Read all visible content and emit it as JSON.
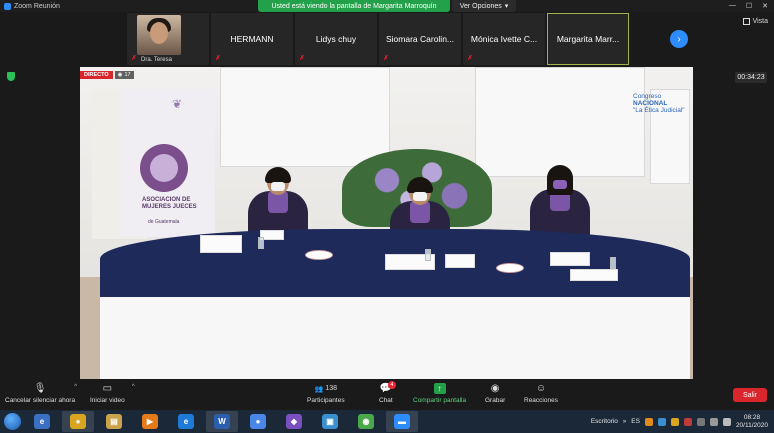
{
  "window": {
    "title": "Zoom Reunión",
    "minimize_label": "—",
    "maximize_label": "☐",
    "close_label": "✕"
  },
  "banner": {
    "share_notice": "Usted está viendo la pantalla de Margarita Marroquín",
    "view_options": "Ver Opciones",
    "view_options_caret": "▾"
  },
  "gallery": {
    "participants": [
      {
        "name": "Dra. Teresa",
        "has_video": true
      },
      {
        "name": "HERMANN",
        "has_video": false
      },
      {
        "name": "Lidys chuy",
        "has_video": false
      },
      {
        "name": "Siomara  Carolin...",
        "has_video": false
      },
      {
        "name": "Mónica Ivette C...",
        "has_video": false
      },
      {
        "name": "Margarita  Marr...",
        "has_video": false,
        "active": true
      }
    ],
    "next_label": "›",
    "view_label": "Vista"
  },
  "meeting": {
    "elapsed": "00:34:23"
  },
  "shared_screen": {
    "live_label": "DIRECTO",
    "viewer_count": "17",
    "banner_org": "ASOCIACION DE MUJERES JUECES",
    "banner_org_sub": "de Guatemala",
    "brand_line1": "Congreso",
    "brand_line2": "NACIONAL",
    "brand_line3": "\"La Ética Judicial\""
  },
  "toolbar": {
    "mute_label": "Cancelar silenciar ahora",
    "video_label": "Iniciar video",
    "participants_label": "Participantes",
    "participants_count": "138",
    "chat_label": "Chat",
    "chat_badge": "4",
    "share_label": "Compartir pantalla",
    "record_label": "Grabar",
    "reactions_label": "Reacciones",
    "leave_label": "Salir",
    "caret": "^"
  },
  "taskbar": {
    "apps": [
      {
        "name": "ie-old",
        "glyph": "e",
        "color": "#3a6fc2"
      },
      {
        "name": "chrome",
        "glyph": "●",
        "color": "#d9a420"
      },
      {
        "name": "explorer",
        "glyph": "▤",
        "color": "#c9a24a"
      },
      {
        "name": "media-player",
        "glyph": "▶",
        "color": "#e57a1a"
      },
      {
        "name": "internet-explorer",
        "glyph": "e",
        "color": "#1f7ad6"
      },
      {
        "name": "word",
        "glyph": "W",
        "color": "#2b5fae"
      },
      {
        "name": "chrome-2",
        "glyph": "●",
        "color": "#4a86e8"
      },
      {
        "name": "visual-studio",
        "glyph": "◆",
        "color": "#7a4fc0"
      },
      {
        "name": "network",
        "glyph": "▣",
        "color": "#3a8fd0"
      },
      {
        "name": "maps",
        "glyph": "◉",
        "color": "#4aa84a"
      },
      {
        "name": "zoom",
        "glyph": "▬",
        "color": "#2d8cff"
      }
    ],
    "desktop_label": "Escritorio",
    "language": "ES",
    "time": "08:28",
    "date": "20/11/2020"
  },
  "colors": {
    "accent": "#2d8cff",
    "share_green": "#23a14a",
    "leave_red": "#d9262c",
    "live_red": "#d9262c"
  }
}
